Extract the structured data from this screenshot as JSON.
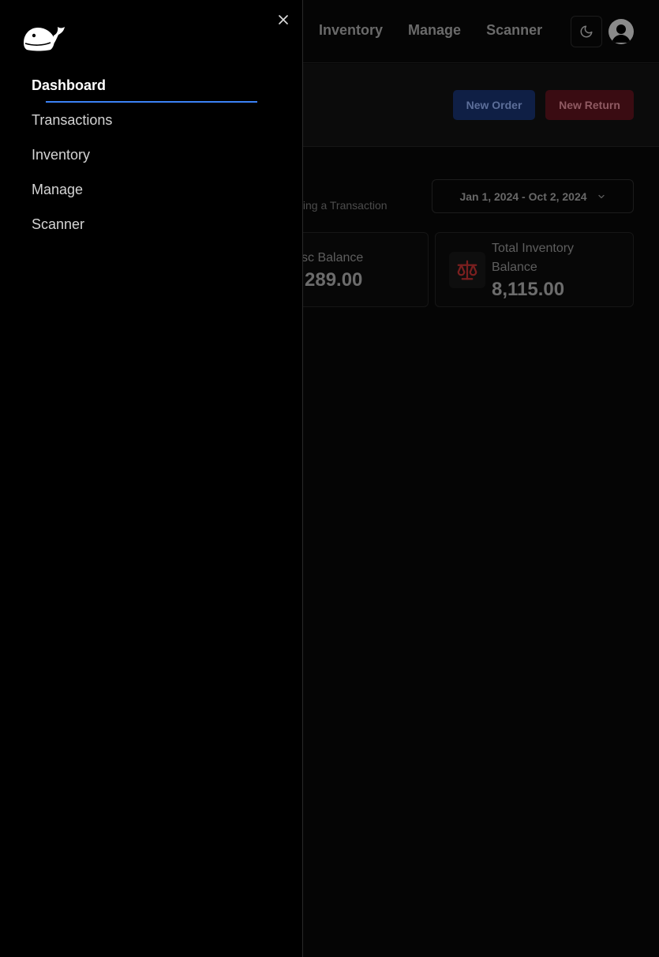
{
  "app": {
    "top_nav": [
      {
        "label": "Inventory"
      },
      {
        "label": "Manage"
      },
      {
        "label": "Scanner"
      }
    ]
  },
  "actions": {
    "new_order": "New Order",
    "new_return": "New Return"
  },
  "dashboard": {
    "subtitle_partial": "ting a Transaction",
    "date_range": "Jan 1, 2024 - Oct 2, 2024",
    "cards": {
      "misc": {
        "label": "sc Balance",
        "value": "289.00"
      },
      "inventory": {
        "label_line1": "Total Inventory",
        "label_line2": "Balance",
        "value": "8,115.00"
      }
    }
  },
  "drawer": {
    "items": [
      {
        "label": "Dashboard",
        "active": true
      },
      {
        "label": "Transactions"
      },
      {
        "label": "Inventory"
      },
      {
        "label": "Manage"
      },
      {
        "label": "Scanner"
      }
    ]
  },
  "colors": {
    "accent": "#3b82f6",
    "order_button": "#0f1f45",
    "return_button": "#3a0c12",
    "scale_icon": "#7a1f1f"
  },
  "icons": {
    "logo": "whale-logo-icon",
    "close": "close-icon",
    "theme": "moon-icon",
    "avatar": "user-avatar-icon",
    "date": "chevron-down-icon",
    "balance": "scale-icon"
  }
}
